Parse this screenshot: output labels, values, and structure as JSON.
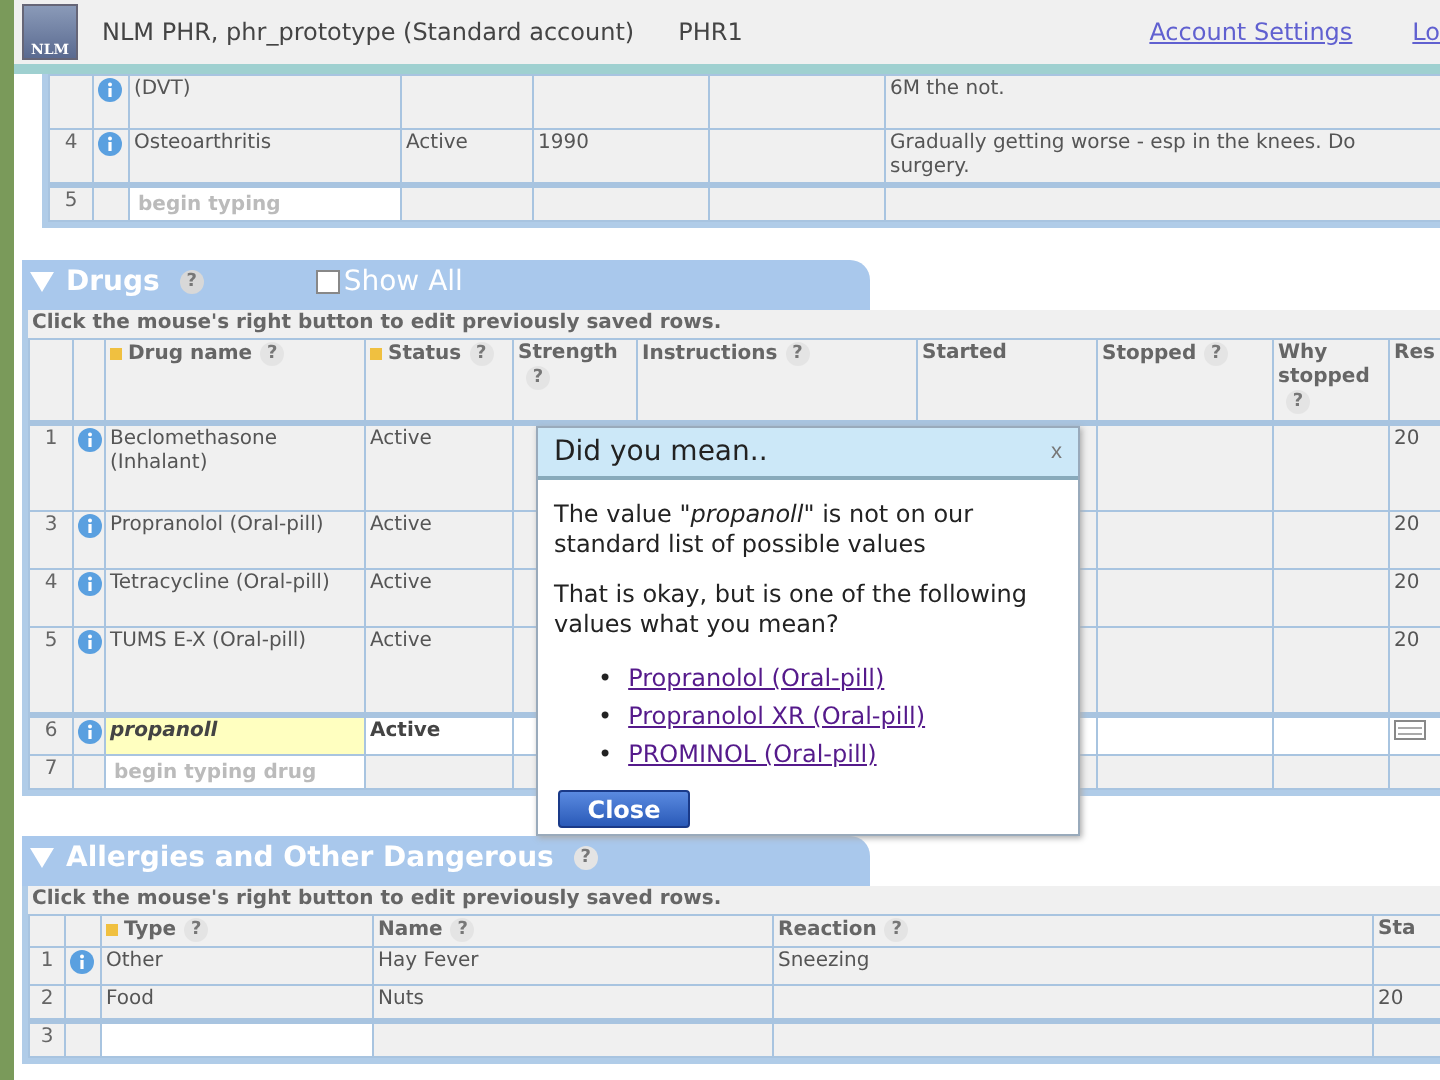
{
  "header": {
    "logo": "NLM",
    "title": "NLM PHR, phr_prototype (Standard account)",
    "profile": "PHR1",
    "links": [
      "Account Settings",
      "Lo"
    ]
  },
  "conditions": {
    "rows": [
      {
        "number": "",
        "info": true,
        "cells": [
          "(DVT)",
          "",
          "",
          "",
          [
            "6M the not."
          ]
        ]
      },
      {
        "number": "4",
        "info": true,
        "cells": [
          "Osteoarthritis",
          "Active",
          "1990",
          "",
          [
            "Gradually getting worse - esp in the knees. Do",
            "surgery."
          ]
        ]
      }
    ],
    "new_row": {
      "number": "5",
      "placeholder": "begin typing"
    }
  },
  "drugs": {
    "title": "Drugs",
    "help": "?",
    "expanded": true,
    "show_all": {
      "label": "Show All",
      "checked": false
    },
    "instruction": "Click the mouse's right button to edit previously saved rows.",
    "columns": [
      {
        "label": "Drug name",
        "sortable": true,
        "help": "?"
      },
      {
        "label": "Status",
        "sortable": true,
        "help": "?"
      },
      {
        "label": "Strength",
        "sortable": false,
        "help": "?"
      },
      {
        "label": "Instructions",
        "sortable": false,
        "help": "?"
      },
      {
        "label": "Started",
        "sortable": false
      },
      {
        "label": "Stopped",
        "sortable": false,
        "help": "?"
      },
      {
        "label": "Why stopped",
        "sortable": false,
        "help": "?"
      },
      {
        "label": "Res",
        "sortable": false
      }
    ],
    "rows": [
      {
        "number": "1",
        "info": true,
        "selected": false,
        "cells": [
          "Beclomethasone (Inhalant)",
          "Active",
          "",
          "",
          "",
          "",
          "",
          "20"
        ]
      },
      {
        "number": "3",
        "info": true,
        "selected": false,
        "cells": [
          "Propranolol (Oral-pill)",
          "Active",
          "",
          "",
          "",
          "",
          "",
          "20"
        ]
      },
      {
        "number": "4",
        "info": true,
        "selected": false,
        "cells": [
          "Tetracycline (Oral-pill)",
          "Active",
          "",
          "",
          "",
          "",
          "",
          "20"
        ]
      },
      {
        "number": "5",
        "info": true,
        "selected": false,
        "cells": [
          "TUMS E-X (Oral-pill)",
          "Active",
          "",
          "",
          "",
          "",
          "",
          "20"
        ]
      },
      {
        "number": "6",
        "info": true,
        "selected": true,
        "cells": [
          "propanoll",
          "Active",
          "",
          "",
          "",
          "",
          "",
          ""
        ]
      }
    ],
    "new_row": {
      "number": "7",
      "placeholder": "begin typing drug"
    }
  },
  "dialog": {
    "title": "Did you mean..",
    "close": "x",
    "message": "The value \"*propanoll*\" is not on our standard list of possible values",
    "question": "That is okay, but is one of the following values what you mean?",
    "bullet": "•",
    "suggestions": [
      "Propranolol (Oral-pill)",
      "Propranolol XR (Oral-pill)",
      "PROMINOL (Oral-pill)"
    ],
    "button": "Close"
  },
  "allergies": {
    "title": "Allergies and Other Dangerous",
    "help": "?",
    "expanded": true,
    "instruction": "Click the mouse's right button to edit previously saved rows.",
    "columns": [
      {
        "label": "Type",
        "sortable": true,
        "help": "?"
      },
      {
        "label": "Name",
        "sortable": false,
        "help": "?"
      },
      {
        "label": "Reaction",
        "sortable": false,
        "help": "?"
      },
      {
        "label": "Sta",
        "sortable": false
      }
    ],
    "rows": [
      {
        "number": "1",
        "info": true,
        "cells": [
          "Other",
          "Hay Fever",
          "Sneezing",
          ""
        ]
      },
      {
        "number": "2",
        "info": false,
        "cells": [
          "Food",
          "Nuts",
          "",
          "20"
        ]
      }
    ],
    "new_row": {
      "number": "3"
    }
  }
}
